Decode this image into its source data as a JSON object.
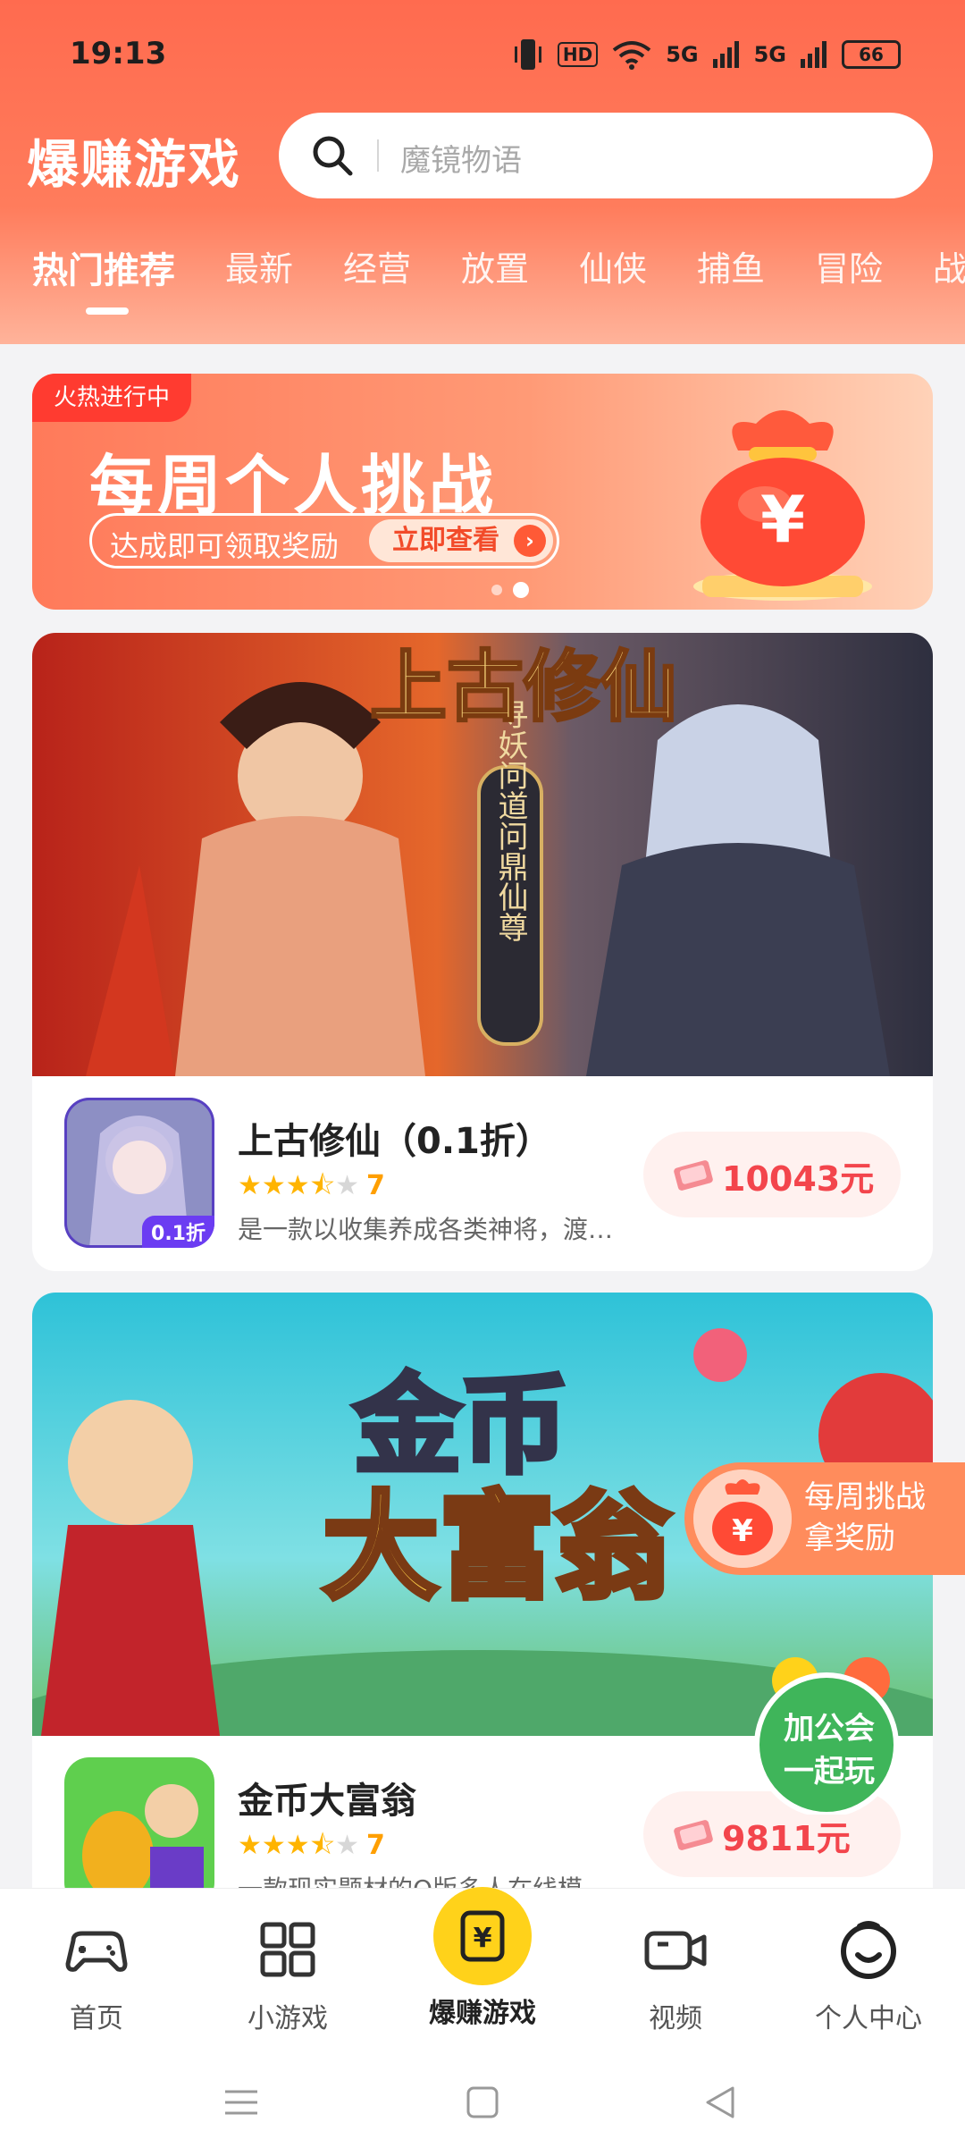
{
  "status_bar": {
    "time": "19:13",
    "hd_label": "HD",
    "net_labels": [
      "5G",
      "5G"
    ],
    "battery": "66"
  },
  "header": {
    "title": "爆赚游戏",
    "search_placeholder": "魔镜物语"
  },
  "tabs": [
    "热门推荐",
    "最新",
    "经营",
    "放置",
    "仙侠",
    "捕鱼",
    "冒险",
    "战"
  ],
  "banner": {
    "badge": "火热进行中",
    "title": "每周个人挑战",
    "subtitle": "达成即可领取奖励",
    "cta": "立即查看"
  },
  "games": [
    {
      "name": "上古修仙（0.1折）",
      "rating": 3.5,
      "rating_text": "7",
      "description": "是一款以收集养成各类神将，渡…",
      "reward": "10043元",
      "discount_badge": "0.1折",
      "art_title": "上古修仙",
      "art_caption": "寻妖问道问鼎仙尊"
    },
    {
      "name": "金币大富翁",
      "rating": 3.5,
      "rating_text": "7",
      "description": "一款现实题材的Q版多人在线模…",
      "reward": "9811元",
      "art_title_1": "金币",
      "art_title_2": "大富翁"
    }
  ],
  "floating": {
    "challenge_line1": "每周挑战",
    "challenge_line2": "拿奖励",
    "guild_line1": "加公会",
    "guild_line2": "一起玩"
  },
  "bottom_nav": [
    {
      "label": "首页",
      "icon": "gamepad-icon"
    },
    {
      "label": "小游戏",
      "icon": "grid-icon"
    },
    {
      "label": "爆赚游戏",
      "icon": "yuan-coin-icon"
    },
    {
      "label": "视频",
      "icon": "video-icon"
    },
    {
      "label": "个人中心",
      "icon": "smile-face-icon"
    }
  ],
  "colors": {
    "header_orange": "#ff6b4f",
    "reward_red": "#f3454c",
    "nav_accent_yellow": "#ffd21a",
    "star_yellow": "#ffb400"
  }
}
